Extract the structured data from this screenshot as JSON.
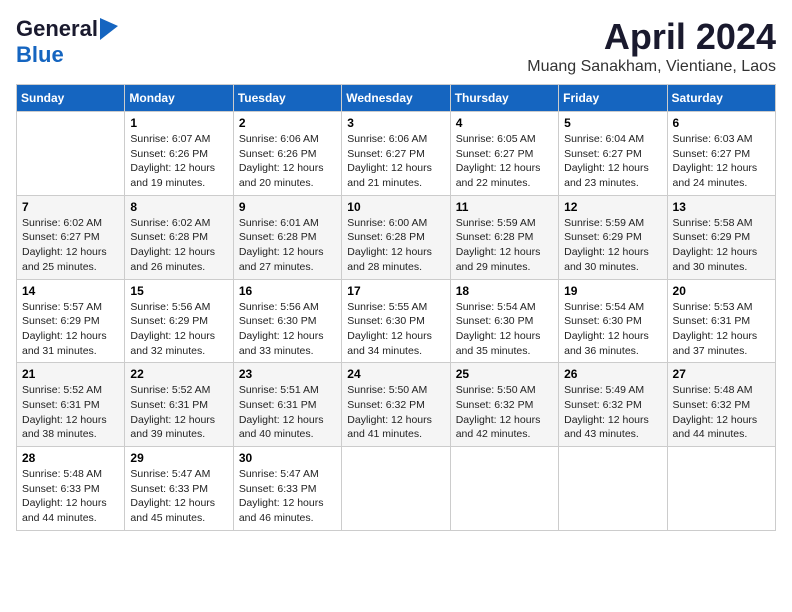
{
  "logo": {
    "general": "General",
    "blue": "Blue"
  },
  "title": "April 2024",
  "location": "Muang Sanakham, Vientiane, Laos",
  "days_of_week": [
    "Sunday",
    "Monday",
    "Tuesday",
    "Wednesday",
    "Thursday",
    "Friday",
    "Saturday"
  ],
  "weeks": [
    [
      {
        "day": "",
        "sunrise": "",
        "sunset": "",
        "daylight": ""
      },
      {
        "day": "1",
        "sunrise": "Sunrise: 6:07 AM",
        "sunset": "Sunset: 6:26 PM",
        "daylight": "Daylight: 12 hours and 19 minutes."
      },
      {
        "day": "2",
        "sunrise": "Sunrise: 6:06 AM",
        "sunset": "Sunset: 6:26 PM",
        "daylight": "Daylight: 12 hours and 20 minutes."
      },
      {
        "day": "3",
        "sunrise": "Sunrise: 6:06 AM",
        "sunset": "Sunset: 6:27 PM",
        "daylight": "Daylight: 12 hours and 21 minutes."
      },
      {
        "day": "4",
        "sunrise": "Sunrise: 6:05 AM",
        "sunset": "Sunset: 6:27 PM",
        "daylight": "Daylight: 12 hours and 22 minutes."
      },
      {
        "day": "5",
        "sunrise": "Sunrise: 6:04 AM",
        "sunset": "Sunset: 6:27 PM",
        "daylight": "Daylight: 12 hours and 23 minutes."
      },
      {
        "day": "6",
        "sunrise": "Sunrise: 6:03 AM",
        "sunset": "Sunset: 6:27 PM",
        "daylight": "Daylight: 12 hours and 24 minutes."
      }
    ],
    [
      {
        "day": "7",
        "sunrise": "Sunrise: 6:02 AM",
        "sunset": "Sunset: 6:27 PM",
        "daylight": "Daylight: 12 hours and 25 minutes."
      },
      {
        "day": "8",
        "sunrise": "Sunrise: 6:02 AM",
        "sunset": "Sunset: 6:28 PM",
        "daylight": "Daylight: 12 hours and 26 minutes."
      },
      {
        "day": "9",
        "sunrise": "Sunrise: 6:01 AM",
        "sunset": "Sunset: 6:28 PM",
        "daylight": "Daylight: 12 hours and 27 minutes."
      },
      {
        "day": "10",
        "sunrise": "Sunrise: 6:00 AM",
        "sunset": "Sunset: 6:28 PM",
        "daylight": "Daylight: 12 hours and 28 minutes."
      },
      {
        "day": "11",
        "sunrise": "Sunrise: 5:59 AM",
        "sunset": "Sunset: 6:28 PM",
        "daylight": "Daylight: 12 hours and 29 minutes."
      },
      {
        "day": "12",
        "sunrise": "Sunrise: 5:59 AM",
        "sunset": "Sunset: 6:29 PM",
        "daylight": "Daylight: 12 hours and 30 minutes."
      },
      {
        "day": "13",
        "sunrise": "Sunrise: 5:58 AM",
        "sunset": "Sunset: 6:29 PM",
        "daylight": "Daylight: 12 hours and 30 minutes."
      }
    ],
    [
      {
        "day": "14",
        "sunrise": "Sunrise: 5:57 AM",
        "sunset": "Sunset: 6:29 PM",
        "daylight": "Daylight: 12 hours and 31 minutes."
      },
      {
        "day": "15",
        "sunrise": "Sunrise: 5:56 AM",
        "sunset": "Sunset: 6:29 PM",
        "daylight": "Daylight: 12 hours and 32 minutes."
      },
      {
        "day": "16",
        "sunrise": "Sunrise: 5:56 AM",
        "sunset": "Sunset: 6:30 PM",
        "daylight": "Daylight: 12 hours and 33 minutes."
      },
      {
        "day": "17",
        "sunrise": "Sunrise: 5:55 AM",
        "sunset": "Sunset: 6:30 PM",
        "daylight": "Daylight: 12 hours and 34 minutes."
      },
      {
        "day": "18",
        "sunrise": "Sunrise: 5:54 AM",
        "sunset": "Sunset: 6:30 PM",
        "daylight": "Daylight: 12 hours and 35 minutes."
      },
      {
        "day": "19",
        "sunrise": "Sunrise: 5:54 AM",
        "sunset": "Sunset: 6:30 PM",
        "daylight": "Daylight: 12 hours and 36 minutes."
      },
      {
        "day": "20",
        "sunrise": "Sunrise: 5:53 AM",
        "sunset": "Sunset: 6:31 PM",
        "daylight": "Daylight: 12 hours and 37 minutes."
      }
    ],
    [
      {
        "day": "21",
        "sunrise": "Sunrise: 5:52 AM",
        "sunset": "Sunset: 6:31 PM",
        "daylight": "Daylight: 12 hours and 38 minutes."
      },
      {
        "day": "22",
        "sunrise": "Sunrise: 5:52 AM",
        "sunset": "Sunset: 6:31 PM",
        "daylight": "Daylight: 12 hours and 39 minutes."
      },
      {
        "day": "23",
        "sunrise": "Sunrise: 5:51 AM",
        "sunset": "Sunset: 6:31 PM",
        "daylight": "Daylight: 12 hours and 40 minutes."
      },
      {
        "day": "24",
        "sunrise": "Sunrise: 5:50 AM",
        "sunset": "Sunset: 6:32 PM",
        "daylight": "Daylight: 12 hours and 41 minutes."
      },
      {
        "day": "25",
        "sunrise": "Sunrise: 5:50 AM",
        "sunset": "Sunset: 6:32 PM",
        "daylight": "Daylight: 12 hours and 42 minutes."
      },
      {
        "day": "26",
        "sunrise": "Sunrise: 5:49 AM",
        "sunset": "Sunset: 6:32 PM",
        "daylight": "Daylight: 12 hours and 43 minutes."
      },
      {
        "day": "27",
        "sunrise": "Sunrise: 5:48 AM",
        "sunset": "Sunset: 6:32 PM",
        "daylight": "Daylight: 12 hours and 44 minutes."
      }
    ],
    [
      {
        "day": "28",
        "sunrise": "Sunrise: 5:48 AM",
        "sunset": "Sunset: 6:33 PM",
        "daylight": "Daylight: 12 hours and 44 minutes."
      },
      {
        "day": "29",
        "sunrise": "Sunrise: 5:47 AM",
        "sunset": "Sunset: 6:33 PM",
        "daylight": "Daylight: 12 hours and 45 minutes."
      },
      {
        "day": "30",
        "sunrise": "Sunrise: 5:47 AM",
        "sunset": "Sunset: 6:33 PM",
        "daylight": "Daylight: 12 hours and 46 minutes."
      },
      {
        "day": "",
        "sunrise": "",
        "sunset": "",
        "daylight": ""
      },
      {
        "day": "",
        "sunrise": "",
        "sunset": "",
        "daylight": ""
      },
      {
        "day": "",
        "sunrise": "",
        "sunset": "",
        "daylight": ""
      },
      {
        "day": "",
        "sunrise": "",
        "sunset": "",
        "daylight": ""
      }
    ]
  ]
}
